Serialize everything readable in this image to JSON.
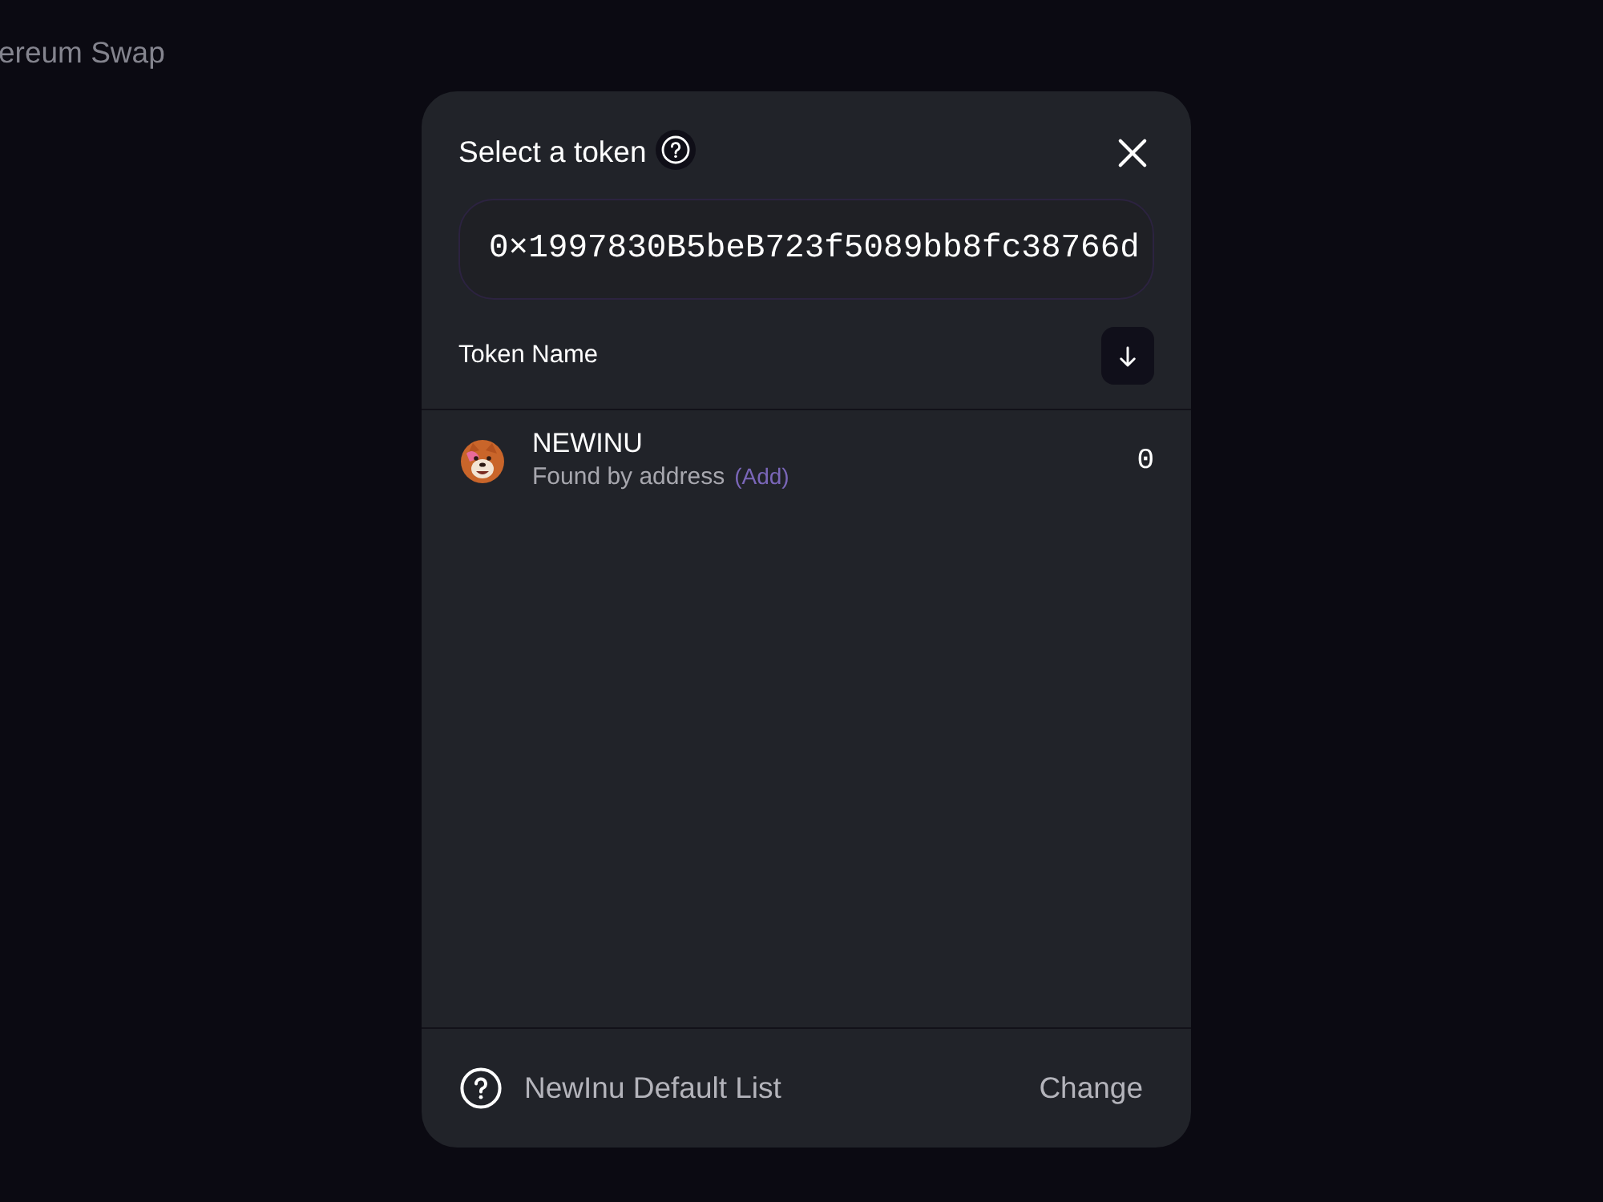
{
  "background": {
    "app_title": "ereum Swap"
  },
  "modal": {
    "title": "Select a token",
    "search": {
      "value": "0×1997830B5beB723f5089bb8fc38766d"
    },
    "list_header": {
      "label": "Token Name"
    },
    "tokens": [
      {
        "symbol": "NEWINU",
        "status": "Found by address",
        "action": "(Add)",
        "balance": "0"
      }
    ],
    "footer": {
      "list_name": "NewInu Default List",
      "button": "Change"
    }
  }
}
